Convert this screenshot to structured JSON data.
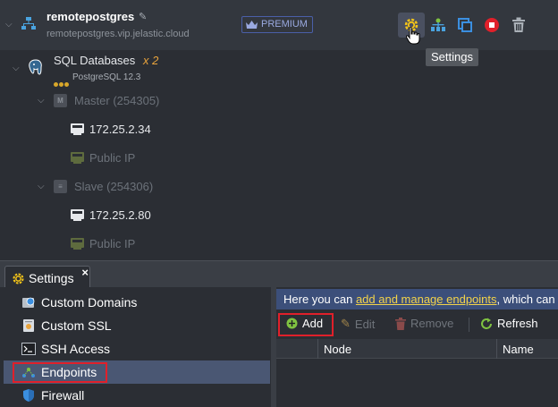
{
  "environment": {
    "name": "remotepostgres",
    "domain": "remotepostgres.vip.jelastic.cloud",
    "badge": "PREMIUM",
    "actions": [
      "settings-icon",
      "add-on-icon",
      "clone-icon",
      "stop-icon",
      "delete-icon"
    ],
    "tooltip": "Settings"
  },
  "layer": {
    "name": "SQL Databases",
    "count": "x 2",
    "stack": "PostgreSQL 12.3"
  },
  "nodes": [
    {
      "name": "Master (254305)",
      "private_ip": "172.25.2.34",
      "public_ip": "Public IP"
    },
    {
      "name": "Slave (254306)",
      "private_ip": "172.25.2.80",
      "public_ip": "Public IP"
    }
  ],
  "settings": {
    "tab_title": "Settings",
    "close": "×",
    "sidebar": [
      {
        "label": "Custom Domains",
        "icon": "globe-icon"
      },
      {
        "label": "Custom SSL",
        "icon": "certificate-icon"
      },
      {
        "label": "SSH Access",
        "icon": "terminal-icon"
      },
      {
        "label": "Endpoints",
        "icon": "endpoints-icon",
        "selected": true
      },
      {
        "label": "Firewall",
        "icon": "shield-icon"
      }
    ],
    "info": {
      "prefix": "Here you can ",
      "link": "add and manage endpoints",
      "suffix": ", which can"
    },
    "toolbar": {
      "add": "Add",
      "edit": "Edit",
      "remove": "Remove",
      "refresh": "Refresh"
    },
    "columns": [
      "Node",
      "Name"
    ]
  },
  "colors": {
    "accent_red": "#e0202a",
    "selected_bg": "#4a5773",
    "info_bar": "#3c4f7a",
    "link_yellow": "#f3d34a",
    "premium_blue": "#9aa9e0",
    "count_orange": "#e8a33d"
  }
}
